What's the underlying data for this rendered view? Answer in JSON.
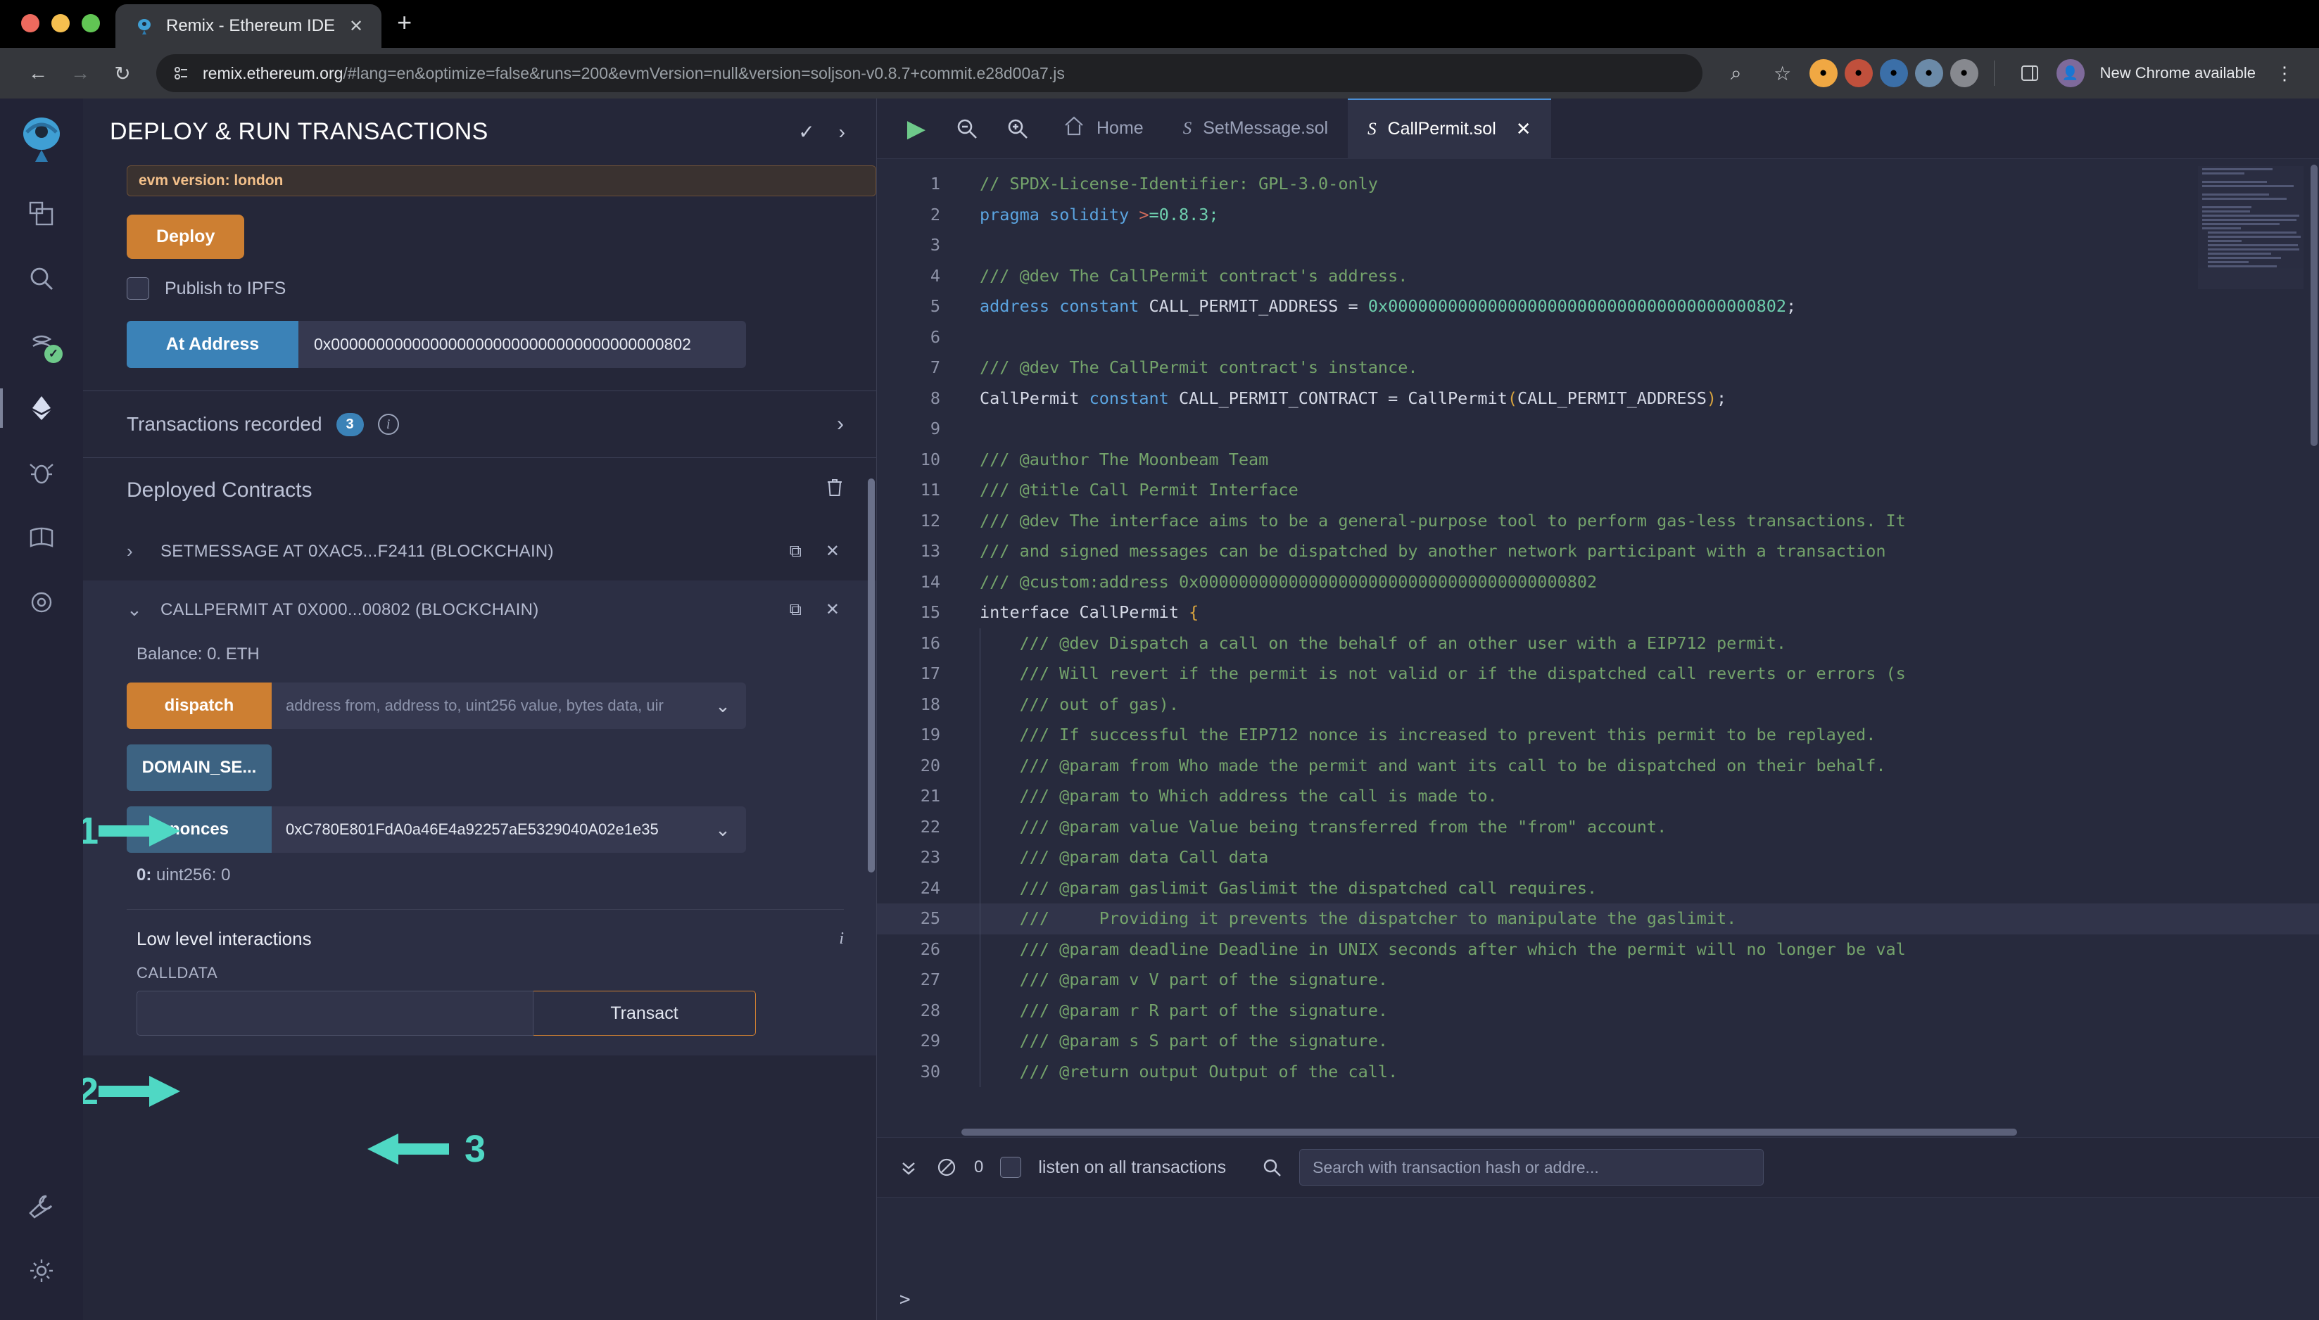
{
  "browser": {
    "tab_title": "Remix - Ethereum IDE",
    "tab_close": "✕",
    "new_tab": "+",
    "back_icon": "←",
    "forward_icon": "→",
    "reload_icon": "↻",
    "url_host": "remix.ethereum.org",
    "url_path": "/#lang=en&optimize=false&runs=200&evmVersion=null&version=soljson-v0.8.7+commit.e28d00a7.js",
    "zoom_icon": "⌕",
    "bookmark_icon": "☆",
    "update_label": "New Chrome available",
    "menu_icon": "⋮",
    "accent": "#3b82b7"
  },
  "panel": {
    "title": "DEPLOY & RUN TRANSACTIONS",
    "check_icon": "✓",
    "chevron_icon": "›",
    "evm_version": "evm version: london",
    "deploy_label": "Deploy",
    "publish_ipfs_label": "Publish to IPFS",
    "at_address_label": "At Address",
    "at_address_value": "0x0000000000000000000000000000000000000802",
    "transactions_recorded_label": "Transactions recorded",
    "transactions_recorded_count": "3",
    "info_icon": "i",
    "expand_icon": "›",
    "deployed_contracts_label": "Deployed Contracts",
    "trash_icon": "🗑",
    "copy_icon": "⧉",
    "close_icon": "✕"
  },
  "contracts": [
    {
      "name": "SETMESSAGE AT 0XAC5...F2411 (BLOCKCHAIN)",
      "chevron": "›",
      "expanded": false
    },
    {
      "name": "CALLPERMIT AT 0X000...00802 (BLOCKCHAIN)",
      "chevron": "⌄",
      "expanded": true,
      "balance": "Balance: 0. ETH",
      "functions": [
        {
          "label": "dispatch",
          "style": "orange",
          "placeholder": "address from, address to, uint256 value, bytes data, uir",
          "value": "",
          "has_input": true,
          "caret": "⌄"
        },
        {
          "label": "DOMAIN_SE...",
          "style": "blue",
          "placeholder": "",
          "value": "",
          "has_input": false,
          "caret": ""
        },
        {
          "label": "nonces",
          "style": "blue",
          "placeholder": "",
          "value": "0xC780E801FdA0a46E4a92257aE5329040A02e1e35",
          "has_input": true,
          "caret": "⌄"
        }
      ],
      "result_index": "0:",
      "result_value": "uint256: 0",
      "low_level_title": "Low level interactions",
      "low_level_info": "i",
      "calldata_label": "CALLDATA",
      "calldata_value": "",
      "transact_label": "Transact"
    }
  ],
  "annotations": [
    {
      "number": "1",
      "direction": "right"
    },
    {
      "number": "2",
      "direction": "right"
    },
    {
      "number": "3",
      "direction": "left"
    }
  ],
  "editor": {
    "run_icon": "▶",
    "zoom_out_icon": "⊖",
    "zoom_in_icon": "⊕",
    "home_icon": "⌂",
    "home_label": "Home",
    "tabs": [
      {
        "label": "SetMessage.sol",
        "active": false,
        "icon": "S",
        "close": ""
      },
      {
        "label": "CallPermit.sol",
        "active": true,
        "icon": "S",
        "close": "✕"
      }
    ],
    "highlighted_line": 25,
    "code": [
      {
        "n": 1,
        "indent": false,
        "tokens": [
          [
            "cmt",
            "// SPDX-License-Identifier: GPL-3.0-only"
          ]
        ]
      },
      {
        "n": 2,
        "indent": false,
        "tokens": [
          [
            "kw",
            "pragma"
          ],
          [
            "plain",
            " "
          ],
          [
            "kw",
            "solidity"
          ],
          [
            "plain",
            " "
          ],
          [
            "op",
            ">"
          ],
          [
            "num",
            "=0.8.3;"
          ]
        ]
      },
      {
        "n": 3,
        "indent": false,
        "tokens": [
          [
            "plain",
            ""
          ]
        ]
      },
      {
        "n": 4,
        "indent": false,
        "tokens": [
          [
            "cmt",
            "/// @dev The CallPermit contract's address."
          ]
        ]
      },
      {
        "n": 5,
        "indent": false,
        "tokens": [
          [
            "kw",
            "address"
          ],
          [
            "plain",
            " "
          ],
          [
            "kw",
            "constant"
          ],
          [
            "plain",
            " CALL_PERMIT_ADDRESS = "
          ],
          [
            "num",
            "0x0000000000000000000000000000000000000802"
          ],
          [
            "plain",
            ";"
          ]
        ]
      },
      {
        "n": 6,
        "indent": false,
        "tokens": [
          [
            "plain",
            ""
          ]
        ]
      },
      {
        "n": 7,
        "indent": false,
        "tokens": [
          [
            "cmt",
            "/// @dev The CallPermit contract's instance."
          ]
        ]
      },
      {
        "n": 8,
        "indent": false,
        "tokens": [
          [
            "plain",
            "CallPermit "
          ],
          [
            "kw",
            "constant"
          ],
          [
            "plain",
            " CALL_PERMIT_CONTRACT = CallPermit"
          ],
          [
            "brc",
            "("
          ],
          [
            "plain",
            "CALL_PERMIT_ADDRESS"
          ],
          [
            "brc",
            ")"
          ],
          [
            "plain",
            ";"
          ]
        ]
      },
      {
        "n": 9,
        "indent": false,
        "tokens": [
          [
            "plain",
            ""
          ]
        ]
      },
      {
        "n": 10,
        "indent": false,
        "tokens": [
          [
            "cmt",
            "/// @author The Moonbeam Team"
          ]
        ]
      },
      {
        "n": 11,
        "indent": false,
        "tokens": [
          [
            "cmt",
            "/// @title Call Permit Interface"
          ]
        ]
      },
      {
        "n": 12,
        "indent": false,
        "tokens": [
          [
            "cmt",
            "/// @dev The interface aims to be a general-purpose tool to perform gas-less transactions. It"
          ]
        ]
      },
      {
        "n": 13,
        "indent": false,
        "tokens": [
          [
            "cmt",
            "/// and signed messages can be dispatched by another network participant with a transaction"
          ]
        ]
      },
      {
        "n": 14,
        "indent": false,
        "tokens": [
          [
            "cmt",
            "/// @custom:address 0x0000000000000000000000000000000000000802"
          ]
        ]
      },
      {
        "n": 15,
        "indent": false,
        "tokens": [
          [
            "plain",
            "interface CallPermit "
          ],
          [
            "brc",
            "{"
          ]
        ]
      },
      {
        "n": 16,
        "indent": true,
        "tokens": [
          [
            "cmt",
            "    /// @dev Dispatch a call on the behalf of an other user with a EIP712 permit."
          ]
        ]
      },
      {
        "n": 17,
        "indent": true,
        "tokens": [
          [
            "cmt",
            "    /// Will revert if the permit is not valid or if the dispatched call reverts or errors (s"
          ]
        ]
      },
      {
        "n": 18,
        "indent": true,
        "tokens": [
          [
            "cmt",
            "    /// out of gas)."
          ]
        ]
      },
      {
        "n": 19,
        "indent": true,
        "tokens": [
          [
            "cmt",
            "    /// If successful the EIP712 nonce is increased to prevent this permit to be replayed."
          ]
        ]
      },
      {
        "n": 20,
        "indent": true,
        "tokens": [
          [
            "cmt",
            "    /// @param from Who made the permit and want its call to be dispatched on their behalf."
          ]
        ]
      },
      {
        "n": 21,
        "indent": true,
        "tokens": [
          [
            "cmt",
            "    /// @param to Which address the call is made to."
          ]
        ]
      },
      {
        "n": 22,
        "indent": true,
        "tokens": [
          [
            "cmt",
            "    /// @param value Value being transferred from the \"from\" account."
          ]
        ]
      },
      {
        "n": 23,
        "indent": true,
        "tokens": [
          [
            "cmt",
            "    /// @param data Call data"
          ]
        ]
      },
      {
        "n": 24,
        "indent": true,
        "tokens": [
          [
            "cmt",
            "    /// @param gaslimit Gaslimit the dispatched call requires."
          ]
        ]
      },
      {
        "n": 25,
        "indent": true,
        "tokens": [
          [
            "cmt",
            "    ///     Providing it prevents the dispatcher to manipulate the gaslimit."
          ]
        ]
      },
      {
        "n": 26,
        "indent": true,
        "tokens": [
          [
            "cmt",
            "    /// @param deadline Deadline in UNIX seconds after which the permit will no longer be val"
          ]
        ]
      },
      {
        "n": 27,
        "indent": true,
        "tokens": [
          [
            "cmt",
            "    /// @param v V part of the signature."
          ]
        ]
      },
      {
        "n": 28,
        "indent": true,
        "tokens": [
          [
            "cmt",
            "    /// @param r R part of the signature."
          ]
        ]
      },
      {
        "n": 29,
        "indent": true,
        "tokens": [
          [
            "cmt",
            "    /// @param s S part of the signature."
          ]
        ]
      },
      {
        "n": 30,
        "indent": true,
        "tokens": [
          [
            "cmt",
            "    /// @return output Output of the call."
          ]
        ]
      }
    ]
  },
  "terminal": {
    "collapse_icon": "»",
    "clear_icon": "⃠",
    "count": "0",
    "listen_label": "listen on all transactions",
    "search_icon": "⚲",
    "search_placeholder": "Search with transaction hash or addre...",
    "prompt": ">"
  }
}
